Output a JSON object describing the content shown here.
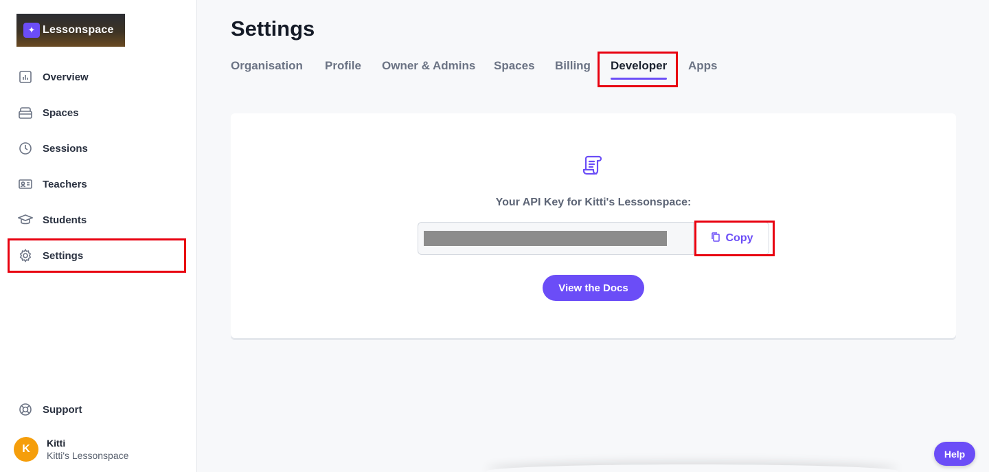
{
  "brand": {
    "name": "Lessonspace"
  },
  "sidebar": {
    "items": [
      {
        "label": "Overview",
        "icon": "chart-icon"
      },
      {
        "label": "Spaces",
        "icon": "layers-icon"
      },
      {
        "label": "Sessions",
        "icon": "clock-icon"
      },
      {
        "label": "Teachers",
        "icon": "id-card-icon"
      },
      {
        "label": "Students",
        "icon": "graduation-cap-icon"
      },
      {
        "label": "Settings",
        "icon": "gear-icon"
      }
    ],
    "support": {
      "label": "Support",
      "icon": "lifebuoy-icon"
    },
    "user": {
      "initial": "K",
      "name": "Kitti",
      "org": "Kitti's Lessonspace"
    }
  },
  "page": {
    "title": "Settings",
    "tabs": [
      {
        "label": "Organisation"
      },
      {
        "label": "Profile"
      },
      {
        "label": "Owner & Admins"
      },
      {
        "label": "Spaces"
      },
      {
        "label": "Billing"
      },
      {
        "label": "Developer",
        "active": true
      },
      {
        "label": "Apps"
      }
    ]
  },
  "developer": {
    "api_label": "Your API Key for Kitti's Lessonspace:",
    "copy_label": "Copy",
    "docs_label": "View the Docs"
  },
  "help": {
    "label": "Help"
  },
  "colors": {
    "accent": "#6b4df7",
    "highlight": "#e8000f"
  }
}
